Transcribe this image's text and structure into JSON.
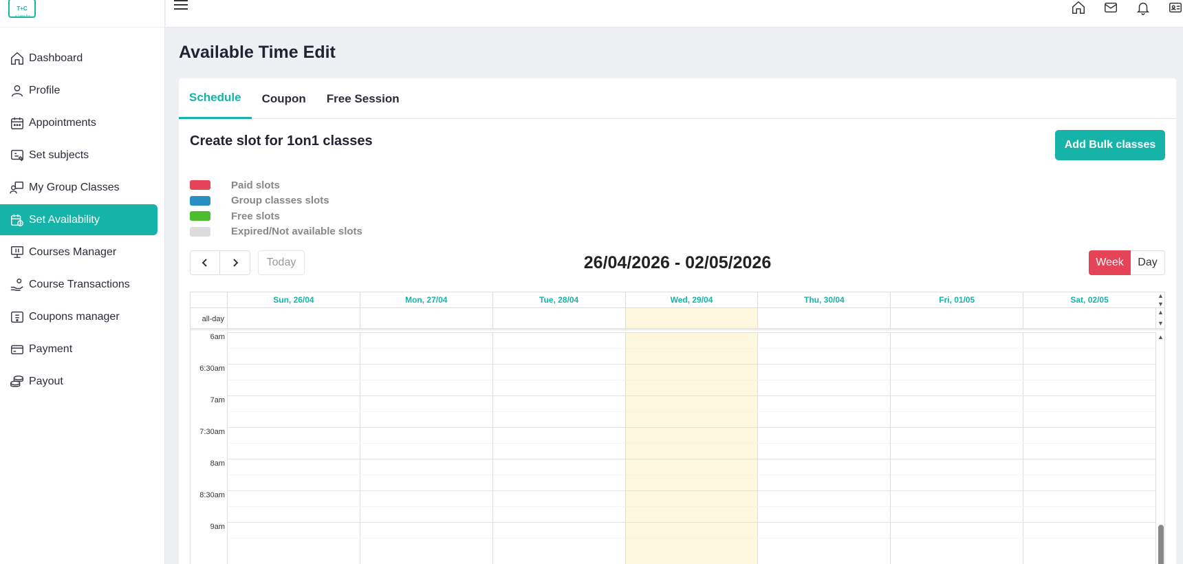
{
  "sidebar": {
    "logo_text": "T+C",
    "logo_sub": "a Tutors Pro",
    "items": [
      {
        "label": "Dashboard",
        "icon": "home-icon"
      },
      {
        "label": "Profile",
        "icon": "user-icon"
      },
      {
        "label": "Appointments",
        "icon": "calendar-icon"
      },
      {
        "label": "Set subjects",
        "icon": "subjects-icon"
      },
      {
        "label": "My Group Classes",
        "icon": "group-classes-icon"
      },
      {
        "label": "Set Availability",
        "icon": "calendar-clock-icon",
        "active": true
      },
      {
        "label": "Courses Manager",
        "icon": "monitor-icon"
      },
      {
        "label": "Course Transactions",
        "icon": "hand-money-icon"
      },
      {
        "label": "Coupons manager",
        "icon": "coupon-icon"
      },
      {
        "label": "Payment",
        "icon": "card-icon"
      },
      {
        "label": "Payout",
        "icon": "coins-icon"
      }
    ]
  },
  "topbar": {
    "icons": [
      "home-icon",
      "mail-icon",
      "bell-icon",
      "id-card-icon"
    ]
  },
  "page": {
    "title": "Available Time Edit"
  },
  "tabs": [
    {
      "label": "Schedule",
      "active": true
    },
    {
      "label": "Coupon"
    },
    {
      "label": "Free Session"
    }
  ],
  "schedule": {
    "section_title": "Create slot for 1on1 classes",
    "bulk_button": "Add Bulk classes",
    "legend": [
      {
        "label": "Paid slots",
        "color": "#e54358"
      },
      {
        "label": "Group classes slots",
        "color": "#2b8fc4"
      },
      {
        "label": "Free slots",
        "color": "#4cbd2c"
      },
      {
        "label": "Expired/Not available slots",
        "color": "#dcdcdc"
      }
    ],
    "today_label": "Today",
    "range_title": "26/04/2026 - 02/05/2026",
    "week_label": "Week",
    "day_label": "Day"
  },
  "calendar": {
    "allday_label": "all-day",
    "days": [
      "Sun, 26/04",
      "Mon, 27/04",
      "Tue, 28/04",
      "Wed, 29/04",
      "Thu, 30/04",
      "Fri, 01/05",
      "Sat, 02/05"
    ],
    "today_index": 3,
    "times": [
      "6am",
      "6:30am",
      "7am",
      "7:30am",
      "8am",
      "8:30am",
      "9am"
    ],
    "colors": {
      "accent": "#15b3a8",
      "today": "#fdf7dd"
    }
  }
}
